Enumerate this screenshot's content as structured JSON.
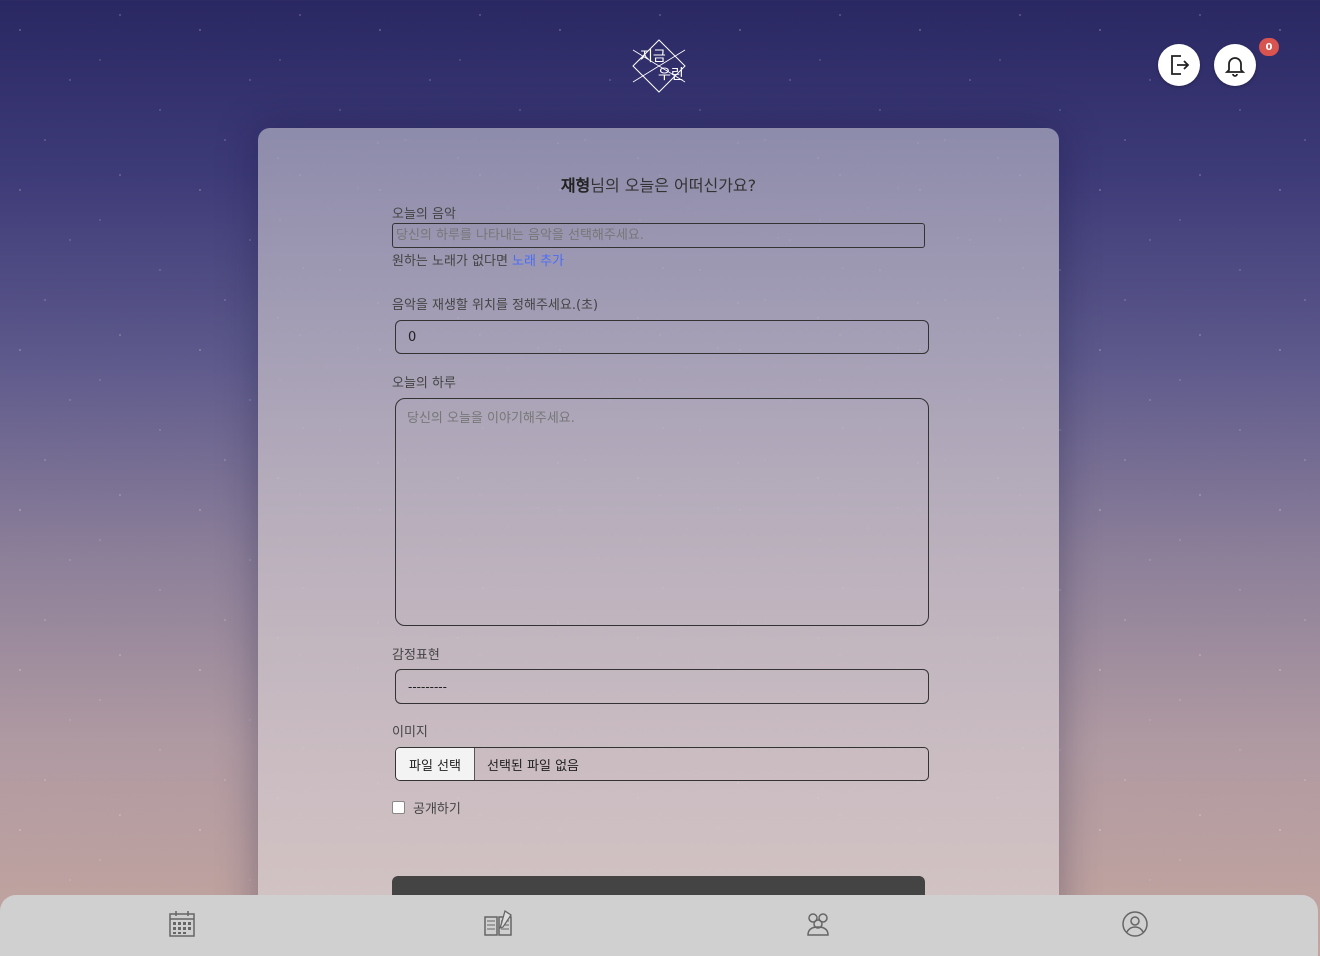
{
  "header": {
    "logo_text_top": "지금",
    "logo_text_bottom": "우린",
    "notification_count": "0"
  },
  "form": {
    "greeting_name": "재형",
    "greeting_rest": "님의 오늘은 어떠신가요?",
    "music_label": "오늘의 음악",
    "music_placeholder": "당신의 하루를 나타내는 음악을 선택해주세요.",
    "add_song_prefix": "원하는 노래가 없다면",
    "add_song_link": "노래 추가",
    "position_label": "음악을 재생할 위치를 정해주세요.(초)",
    "position_value": "0",
    "diary_label": "오늘의 하루",
    "diary_placeholder": "당신의 오늘을 이야기해주세요.",
    "emotion_label": "감정표현",
    "emotion_value": "---------",
    "image_label": "이미지",
    "file_button": "파일 선택",
    "file_status": "선택된 파일 없음",
    "public_label": "공개하기"
  },
  "bottom_nav": {
    "items": [
      "calendar-icon",
      "diary-write-icon",
      "friends-icon",
      "profile-icon"
    ]
  }
}
